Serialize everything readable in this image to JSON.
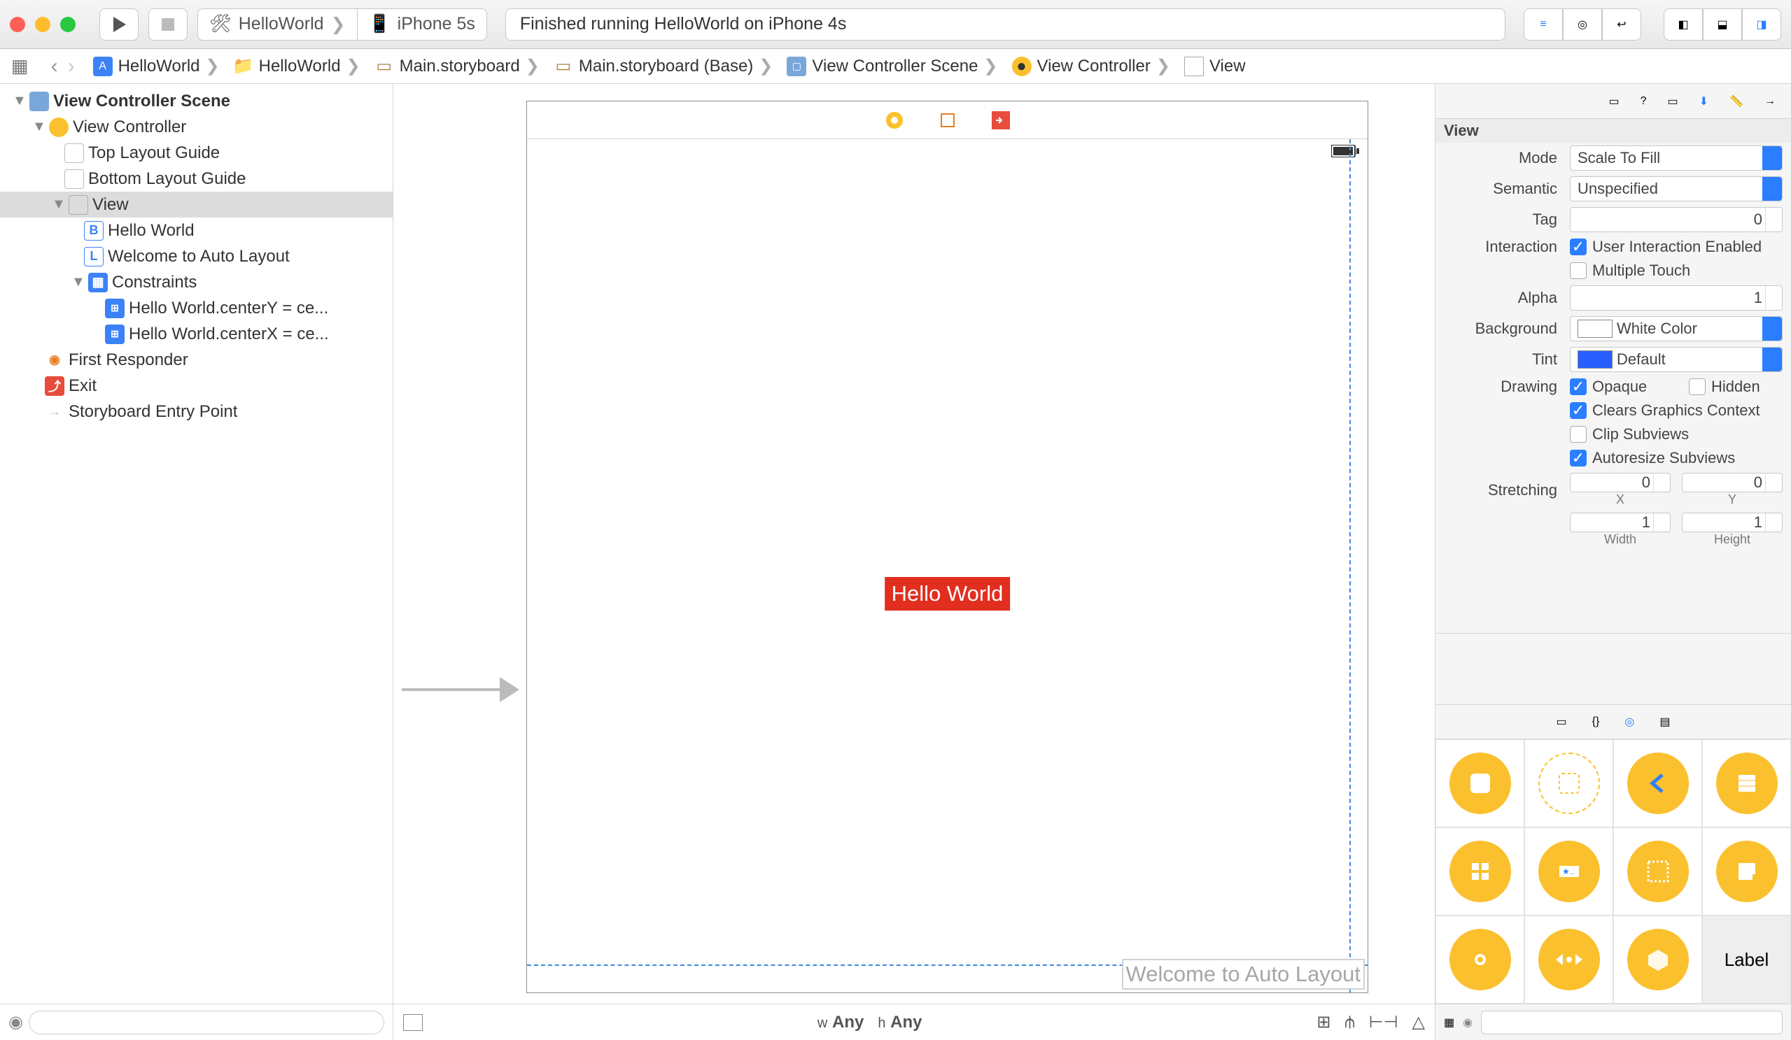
{
  "toolbar": {
    "scheme_project": "HelloWorld",
    "scheme_device": "iPhone 5s",
    "status_text": "Finished running HelloWorld on iPhone 4s"
  },
  "breadcrumbs": [
    "HelloWorld",
    "HelloWorld",
    "Main.storyboard",
    "Main.storyboard (Base)",
    "View Controller Scene",
    "View Controller",
    "View"
  ],
  "outline": {
    "scene": "View Controller Scene",
    "vc": "View Controller",
    "top_guide": "Top Layout Guide",
    "bottom_guide": "Bottom Layout Guide",
    "view": "View",
    "label_hw": "Hello World",
    "label_welcome": "Welcome to Auto Layout",
    "constraints": "Constraints",
    "c1": "Hello World.centerY = ce...",
    "c2": "Hello World.centerX = ce...",
    "first_responder": "First Responder",
    "exit": "Exit",
    "entry": "Storyboard Entry Point"
  },
  "canvas": {
    "hello": "Hello World",
    "welcome": "Welcome to Auto Layout",
    "size_w_prefix": "w",
    "size_w": "Any",
    "size_h_prefix": "h",
    "size_h": "Any"
  },
  "inspector": {
    "header": "View",
    "labels": {
      "mode": "Mode",
      "semantic": "Semantic",
      "tag": "Tag",
      "interaction": "Interaction",
      "alpha": "Alpha",
      "background": "Background",
      "tint": "Tint",
      "drawing": "Drawing",
      "stretching": "Stretching",
      "x": "X",
      "y": "Y",
      "width": "Width",
      "height": "Height"
    },
    "values": {
      "mode": "Scale To Fill",
      "semantic": "Unspecified",
      "tag": "0",
      "uie": "User Interaction Enabled",
      "mt": "Multiple Touch",
      "alpha": "1",
      "background": "White Color",
      "tint": "Default",
      "opaque": "Opaque",
      "hidden": "Hidden",
      "cgc": "Clears Graphics Context",
      "clip": "Clip Subviews",
      "auto": "Autoresize Subviews",
      "sx": "0",
      "sy": "0",
      "sw": "1",
      "sh": "1"
    }
  },
  "library": {
    "last_cell": "Label"
  }
}
